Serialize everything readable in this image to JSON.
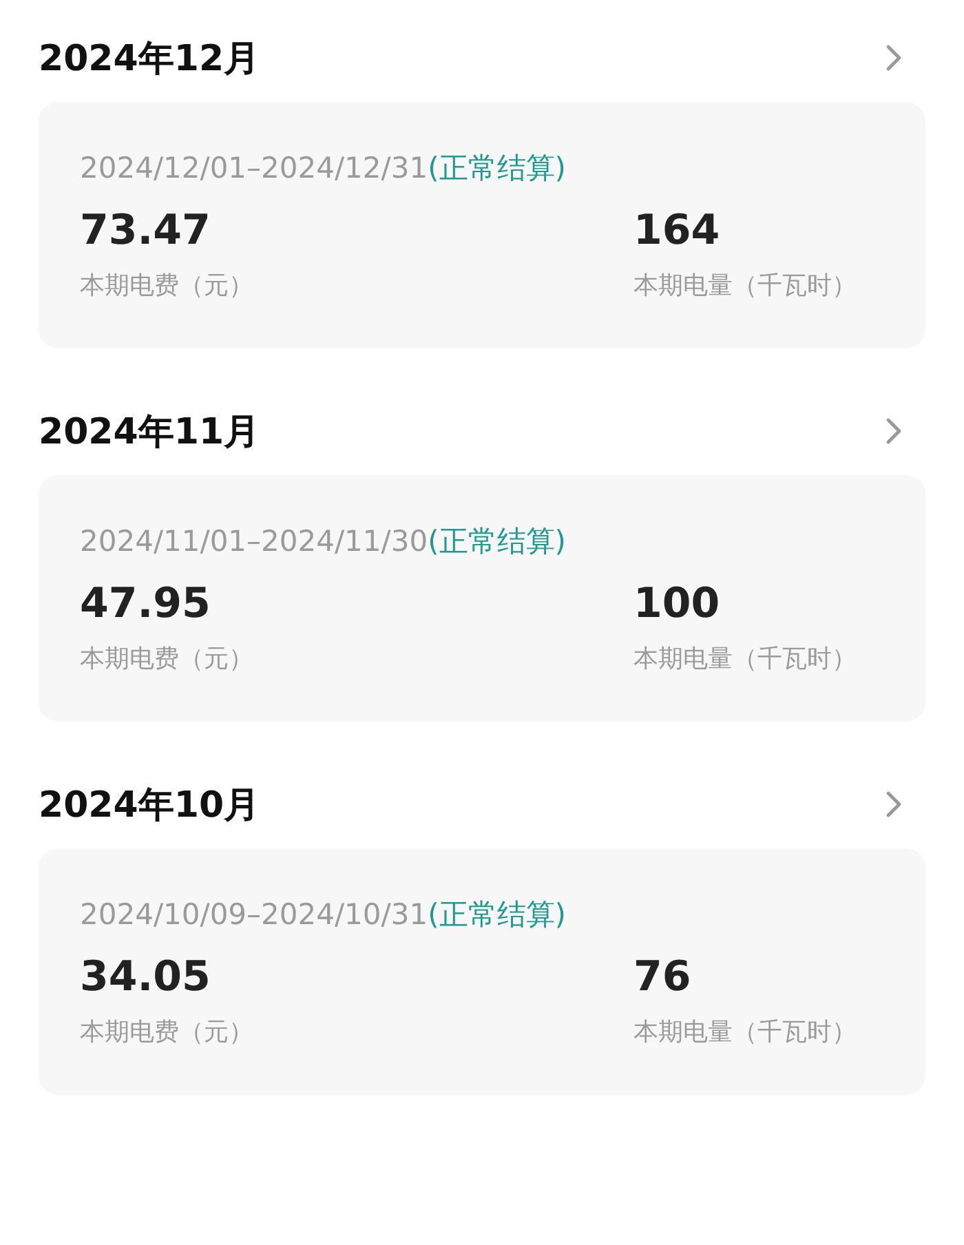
{
  "bills": [
    {
      "month": "2024年12月",
      "period": "2024/12/01–2024/12/31",
      "status": "(正常结算)",
      "fee": "73.47",
      "fee_label": "本期电费（元）",
      "usage": "164",
      "usage_label": "本期电量（千瓦时）"
    },
    {
      "month": "2024年11月",
      "period": "2024/11/01–2024/11/30",
      "status": "(正常结算)",
      "fee": "47.95",
      "fee_label": "本期电费（元）",
      "usage": "100",
      "usage_label": "本期电量（千瓦时）"
    },
    {
      "month": "2024年10月",
      "period": "2024/10/09–2024/10/31",
      "status": "(正常结算)",
      "fee": "34.05",
      "fee_label": "本期电费（元）",
      "usage": "76",
      "usage_label": "本期电量（千瓦时）"
    }
  ]
}
